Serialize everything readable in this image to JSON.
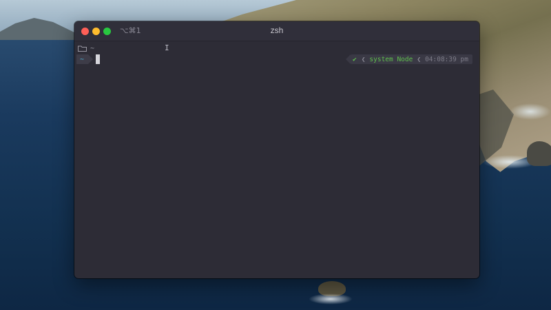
{
  "window": {
    "title": "zsh",
    "tab_shortcut": "⌥⌘1"
  },
  "terminal": {
    "cwd_line": "~",
    "prompt_dir": "~",
    "right_prompt": {
      "status": "✔",
      "separator": "❮",
      "node": "system Node",
      "time": "04:08:39 pm"
    }
  },
  "colors": {
    "window_bg": "#2d2c36",
    "prompt_blue": "#4fb3d9",
    "status_green": "#5fbf4d",
    "close": "#fe5f57",
    "minimize": "#febc2e",
    "maximize": "#28c840"
  },
  "icons": {
    "folder": "folder-icon",
    "mouse": "text-beam-cursor-icon"
  }
}
